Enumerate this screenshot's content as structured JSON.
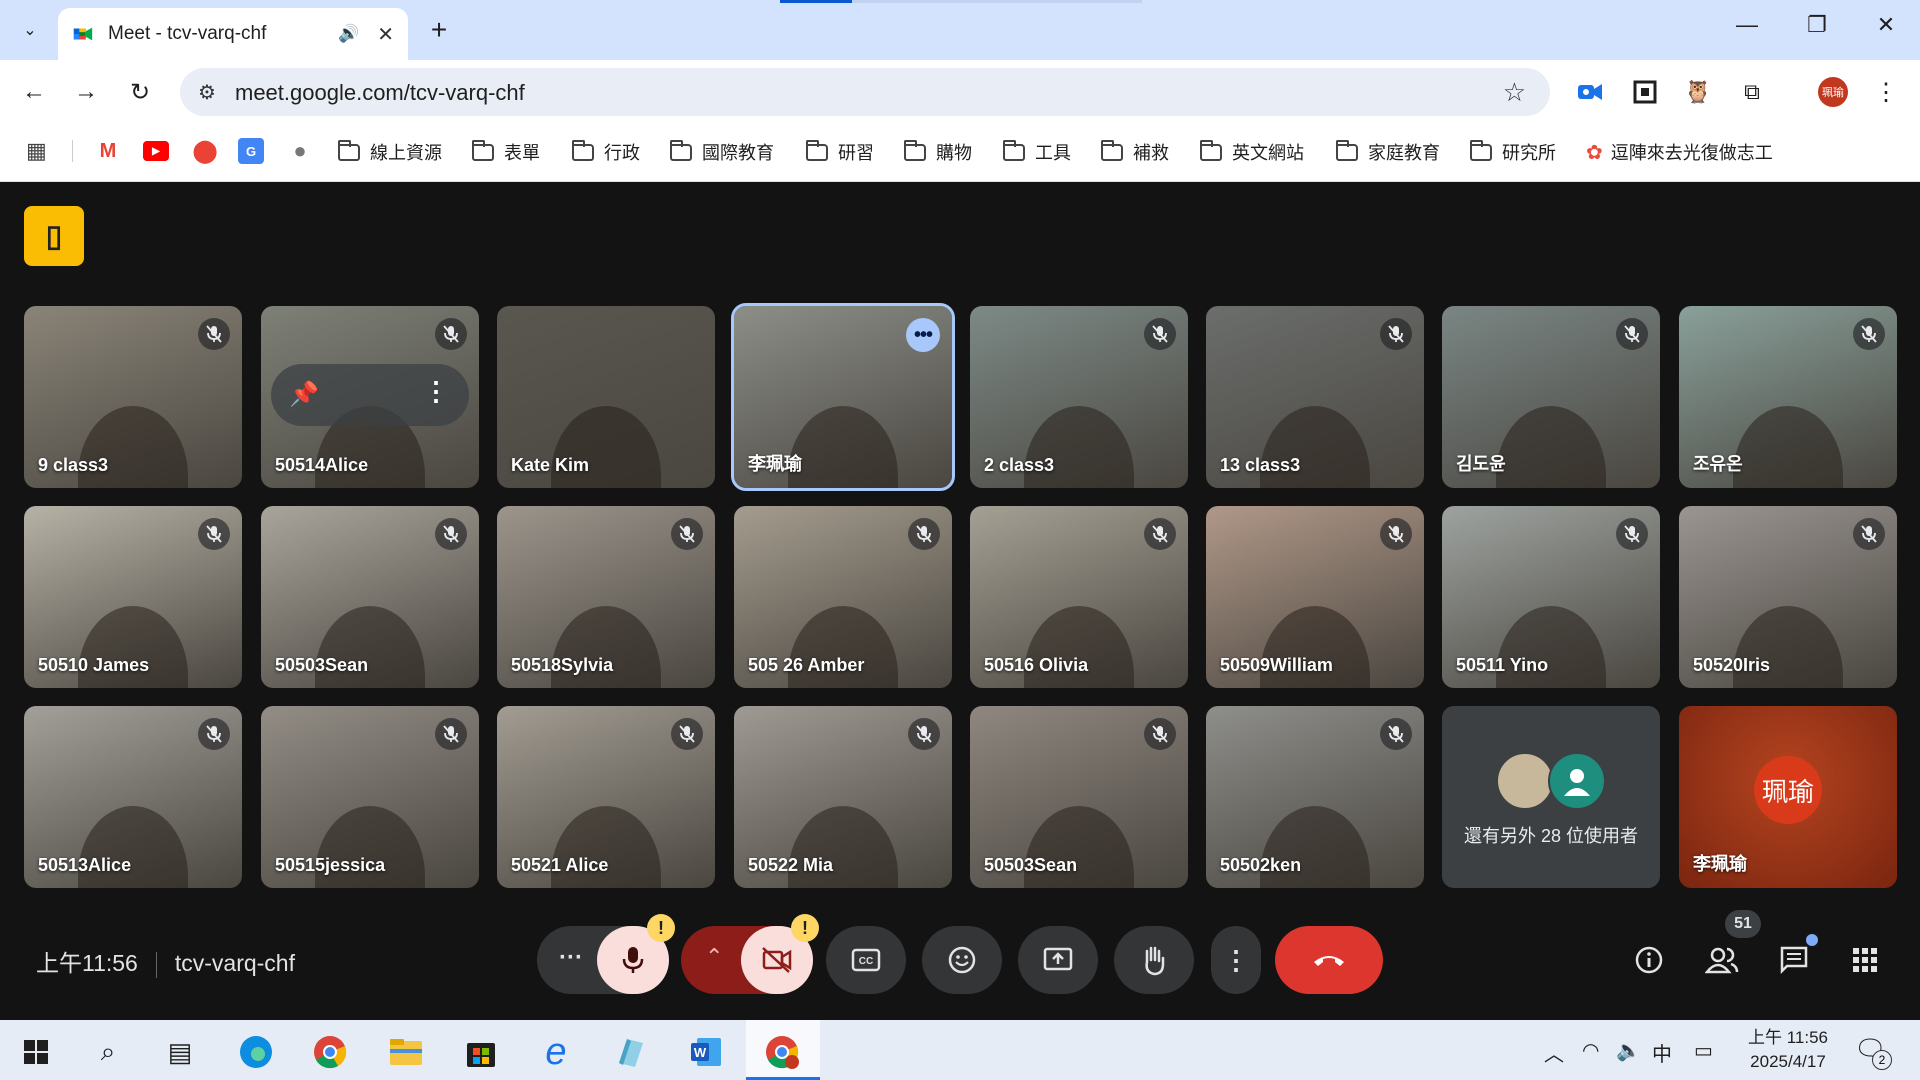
{
  "browser": {
    "tab_title": "Meet - tcv-varq-chf",
    "url": "meet.google.com/tcv-varq-chf",
    "profile_initials": "珮瑜",
    "extension_icons": [
      "meet-extension-icon",
      "qr-icon",
      "owl-icon",
      "puzzle-icon"
    ]
  },
  "bookmarks": [
    {
      "label": "線上資源",
      "type": "folder"
    },
    {
      "label": "表單",
      "type": "folder"
    },
    {
      "label": "行政",
      "type": "folder"
    },
    {
      "label": "國際教育",
      "type": "folder"
    },
    {
      "label": "研習",
      "type": "folder"
    },
    {
      "label": "購物",
      "type": "folder"
    },
    {
      "label": "工具",
      "type": "folder"
    },
    {
      "label": "補救",
      "type": "folder"
    },
    {
      "label": "英文網站",
      "type": "folder"
    },
    {
      "label": "家庭教育",
      "type": "folder"
    },
    {
      "label": "研究所",
      "type": "folder"
    },
    {
      "label": "逗陣來去光復做志工",
      "type": "link"
    }
  ],
  "participants": [
    {
      "name": "9 class3",
      "muted": true,
      "bg": "#8a8478"
    },
    {
      "name": "50514Alice",
      "muted": true,
      "bg": "#7e8178",
      "pinned_hover": true
    },
    {
      "name": "Kate Kim",
      "muted": false,
      "bg": "#5a5650"
    },
    {
      "name": "李珮瑜",
      "muted": false,
      "bg": "#8c8e88",
      "active": true
    },
    {
      "name": "2 class3",
      "muted": true,
      "bg": "#7d8a86"
    },
    {
      "name": "13 class3",
      "muted": true,
      "bg": "#6b6e6c"
    },
    {
      "name": "김도윤",
      "muted": true,
      "bg": "#7a8684"
    },
    {
      "name": "조유온",
      "muted": true,
      "bg": "#8aa09a"
    },
    {
      "name": "50510 James",
      "muted": true,
      "bg": "#b7b2a6"
    },
    {
      "name": "50503Sean",
      "muted": true,
      "bg": "#a9a59c"
    },
    {
      "name": "50518Sylvia",
      "muted": true,
      "bg": "#9c958c"
    },
    {
      "name": "505 26 Amber",
      "muted": true,
      "bg": "#a49c8e"
    },
    {
      "name": "50516 Olivia",
      "muted": true,
      "bg": "#a5a094"
    },
    {
      "name": "50509William",
      "muted": true,
      "bg": "#b09888"
    },
    {
      "name": "50511 Yino",
      "muted": true,
      "bg": "#9ea39f"
    },
    {
      "name": "50520Iris",
      "muted": true,
      "bg": "#9a9590"
    },
    {
      "name": "50513Alice",
      "muted": true,
      "bg": "#a3a09a"
    },
    {
      "name": "50515jessica",
      "muted": true,
      "bg": "#938d86"
    },
    {
      "name": "50521 Alice",
      "muted": true,
      "bg": "#a29c92"
    },
    {
      "name": "50522 Mia",
      "muted": true,
      "bg": "#9f9a93"
    },
    {
      "name": "50503Sean",
      "muted": true,
      "bg": "#8f8780"
    },
    {
      "name": "50502ken",
      "muted": true,
      "bg": "#8e8e8a"
    }
  ],
  "others_tile": {
    "label": "還有另外 28 位使用者"
  },
  "self_tile": {
    "name": "李珮瑜",
    "initials": "珮瑜"
  },
  "controls": {
    "time": "上午11:56",
    "meeting_code": "tcv-varq-chf",
    "people_count": "51",
    "warning": "!"
  },
  "taskbar": {
    "time": "上午 11:56",
    "date": "2025/4/17",
    "ime": "中",
    "notification_count": "2"
  }
}
